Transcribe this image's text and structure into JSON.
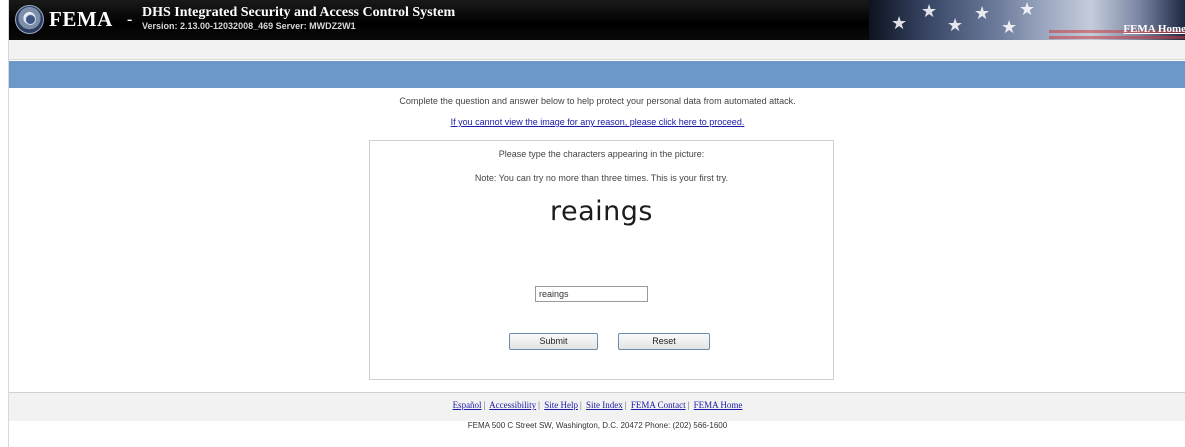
{
  "header": {
    "brand": "FEMA",
    "dash": "-",
    "system_title": "DHS Integrated Security and Access Control System",
    "version_line": "Version: 2.13.00-12032008_469   Server: MWDZ2W1",
    "home_link": "FEMA Home"
  },
  "main": {
    "intro": "Complete the question and answer below to help protect your personal data from automated attack.",
    "proceed_link": "If you cannot view the image for any reason, please click here to proceed.",
    "instruction": "Please type the characters appearing in the picture:",
    "note": "Note: You can try no more than three times. This is your first try.",
    "captcha_text": "reaings",
    "answer_value": "reaings",
    "submit_label": "Submit",
    "reset_label": "Reset"
  },
  "footer": {
    "links": [
      "Español",
      "Accessibility",
      "Site Help",
      "Site Index",
      "FEMA Contact",
      "FEMA Home"
    ],
    "address": "FEMA 500 C Street SW, Washington, D.C. 20472 Phone: (202) 566-1600"
  },
  "colors": {
    "header_bg": "#000000",
    "blue_bar": "#6b98c9",
    "link": "#1a1aa8"
  },
  "icons": {
    "seal": "dhs-seal-icon"
  }
}
